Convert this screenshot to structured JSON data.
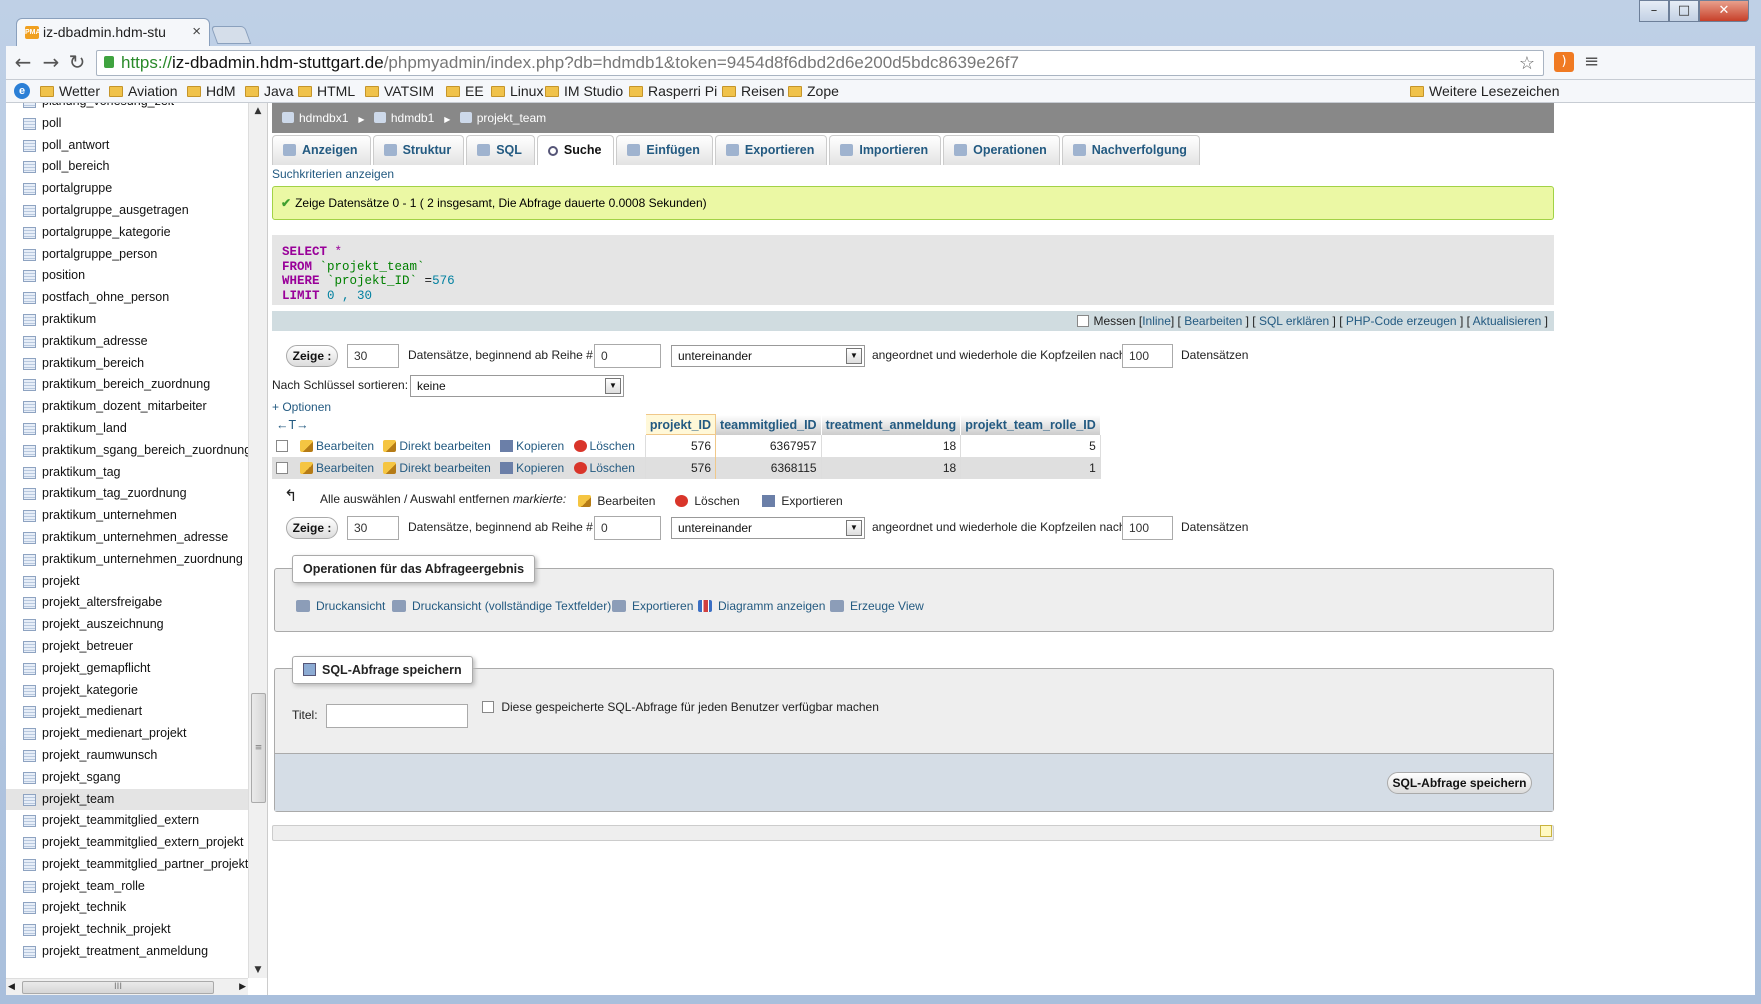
{
  "browser": {
    "tab_title": "iz-dbadmin.hdm-stu",
    "tab_favicon": "PMA",
    "url_scheme": "https://",
    "url_host": "iz-dbadmin.hdm-stuttgart.de",
    "url_path": "/phpmyadmin/index.php?db=hdmdb1&token=9454d8f6dbd2d6e200d5bdc8639e26f7",
    "bookmarks": [
      "Wetter",
      "Aviation",
      "HdM",
      "Java",
      "HTML",
      "VATSIM",
      "EE",
      "Linux",
      "IM Studio",
      "Rasperri Pi",
      "Reisen",
      "Zope"
    ],
    "other_bookmarks": "Weitere Lesezeichen"
  },
  "sidebar": {
    "tables": [
      "planung_vorlesung_zeit",
      "poll",
      "poll_antwort",
      "poll_bereich",
      "portalgruppe",
      "portalgruppe_ausgetragen",
      "portalgruppe_kategorie",
      "portalgruppe_person",
      "position",
      "postfach_ohne_person",
      "praktikum",
      "praktikum_adresse",
      "praktikum_bereich",
      "praktikum_bereich_zuordnung",
      "praktikum_dozent_mitarbeiter",
      "praktikum_land",
      "praktikum_sgang_bereich_zuordnung",
      "praktikum_tag",
      "praktikum_tag_zuordnung",
      "praktikum_unternehmen",
      "praktikum_unternehmen_adresse",
      "praktikum_unternehmen_zuordnung",
      "projekt",
      "projekt_altersfreigabe",
      "projekt_auszeichnung",
      "projekt_betreuer",
      "projekt_gemapflicht",
      "projekt_kategorie",
      "projekt_medienart",
      "projekt_medienart_projekt",
      "projekt_raumwunsch",
      "projekt_sgang",
      "projekt_team",
      "projekt_teammitglied_extern",
      "projekt_teammitglied_extern_projekt",
      "projekt_teammitglied_partner_projekt",
      "projekt_team_rolle",
      "projekt_technik",
      "projekt_technik_projekt",
      "projekt_treatment_anmeldung"
    ],
    "active": "projekt_team",
    "hscroll_grip": "III",
    "vscroll_grip": "≡"
  },
  "breadcrumb": {
    "server": "hdmdbx1",
    "database": "hdmdb1",
    "table": "projekt_team"
  },
  "tabs": [
    "Anzeigen",
    "Struktur",
    "SQL",
    "Suche",
    "Einfügen",
    "Exportieren",
    "Importieren",
    "Operationen",
    "Nachverfolgung"
  ],
  "active_tab": "Suche",
  "search_criteria_link": "Suchkriterien anzeigen",
  "success_message": "Zeige Datensätze 0 - 1 ( 2 insgesamt, Die Abfrage dauerte 0.0008 Sekunden)",
  "sql": {
    "select_kw": "SELECT",
    "select_rest": " *",
    "from_kw": "FROM",
    "from_rest": " `projekt_team`",
    "where_kw": "WHERE",
    "where_col": " `projekt_ID`",
    "where_op": " =",
    "where_val": "576",
    "limit_kw": "LIMIT",
    "limit_rest": " 0 , 30"
  },
  "sql_actions": {
    "profiling": "Messen",
    "inline": "Inline",
    "edit": "Bearbeiten",
    "explain": "SQL erklären",
    "php": "PHP-Code erzeugen",
    "refresh": "Aktualisieren"
  },
  "navigation": {
    "show_button": "Zeige :",
    "rows": "30",
    "rows_label": "Datensätze, beginnend ab Reihe #",
    "start_row": "0",
    "mode": "untereinander",
    "repeat_label": "angeordnet und wiederhole die Kopfzeilen nach",
    "repeat_value": "100",
    "records_label": "Datensätzen"
  },
  "sort": {
    "label": "Nach Schlüssel sortieren:",
    "value": "keine"
  },
  "options_link": "+ Optionen",
  "table": {
    "arrows": "←T→",
    "columns": [
      "projekt_ID",
      "teammitglied_ID",
      "treatment_anmeldung",
      "projekt_team_rolle_ID"
    ],
    "row_actions": {
      "edit": "Bearbeiten",
      "inline_edit": "Direkt bearbeiten",
      "copy": "Kopieren",
      "delete": "Löschen"
    },
    "rows": [
      [
        "576",
        "6367957",
        "18",
        "5"
      ],
      [
        "576",
        "6368115",
        "18",
        "1"
      ]
    ]
  },
  "bulk": {
    "select_all": "Alle auswählen / Auswahl entfernen",
    "marked": "markierte:",
    "edit": "Bearbeiten",
    "delete": "Löschen",
    "export": "Exportieren"
  },
  "query_ops": {
    "legend": "Operationen für das Abfrageergebnis",
    "items": [
      "Druckansicht",
      "Druckansicht (vollständige Textfelder)",
      "Exportieren",
      "Diagramm anzeigen",
      "Erzeuge View"
    ]
  },
  "bookmark": {
    "legend": "SQL-Abfrage speichern",
    "title_label": "Titel:",
    "title_value": "",
    "shared_label": "Diese gespeicherte SQL-Abfrage für jeden Benutzer verfügbar machen",
    "submit": "SQL-Abfrage speichern"
  }
}
